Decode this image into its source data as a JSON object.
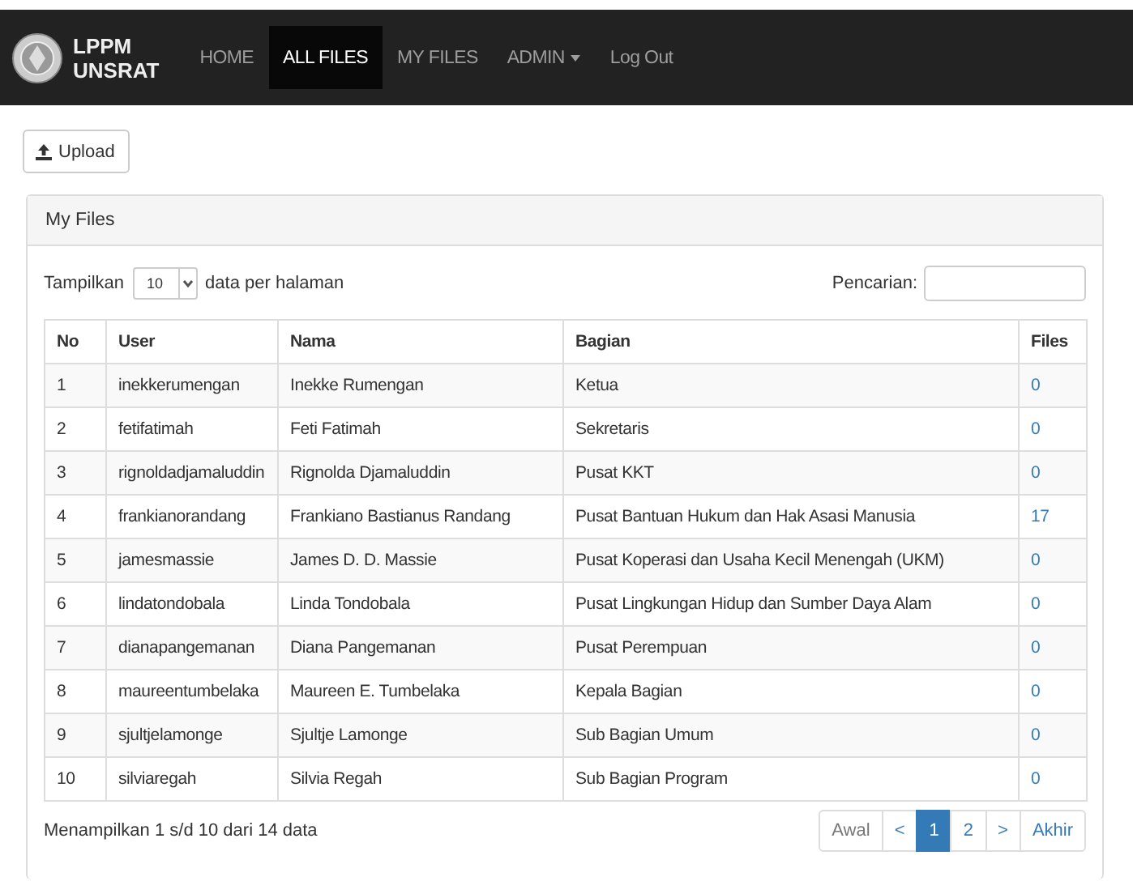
{
  "navbar": {
    "brand": [
      "LPPM",
      "UNSRAT"
    ],
    "items": [
      {
        "label": "HOME",
        "selected": false,
        "kind": "link"
      },
      {
        "label": "ALL FILES",
        "selected": true,
        "kind": "link"
      },
      {
        "label": "MY FILES",
        "selected": false,
        "kind": "link"
      },
      {
        "label": "ADMIN",
        "selected": false,
        "kind": "dropdown"
      },
      {
        "label": "Log Out",
        "selected": false,
        "kind": "link"
      }
    ]
  },
  "upload_button": "Upload",
  "panel": {
    "title": "My Files",
    "length": {
      "prefix": "Tampilkan",
      "value": "10",
      "suffix": "data per halaman"
    },
    "search": {
      "label": "Pencarian:"
    },
    "table": {
      "columns": [
        "No",
        "User",
        "Nama",
        "Bagian",
        "Files"
      ],
      "rows": [
        [
          "1",
          "inekkerumengan",
          "Inekke Rumengan",
          "Ketua",
          "0"
        ],
        [
          "2",
          "fetifatimah",
          "Feti Fatimah",
          "Sekretaris",
          "0"
        ],
        [
          "3",
          "rignoldadjamaluddin",
          "Rignolda Djamaluddin",
          "Pusat KKT",
          "0"
        ],
        [
          "4",
          "frankianorandang",
          "Frankiano Bastianus Randang",
          "Pusat Bantuan Hukum dan Hak Asasi Manusia",
          "17"
        ],
        [
          "5",
          "jamesmassie",
          "James D. D. Massie",
          "Pusat Koperasi dan Usaha Kecil Menengah (UKM)",
          "0"
        ],
        [
          "6",
          "lindatondobala",
          "Linda Tondobala",
          "Pusat Lingkungan Hidup dan Sumber Daya Alam",
          "0"
        ],
        [
          "7",
          "dianapangemanan",
          "Diana Pangemanan",
          "Pusat Perempuan",
          "0"
        ],
        [
          "8",
          "maureentumbelaka",
          "Maureen E. Tumbelaka",
          "Kepala Bagian",
          "0"
        ],
        [
          "9",
          "sjultjelamonge",
          "Sjultje Lamonge",
          "Sub Bagian Umum",
          "0"
        ],
        [
          "10",
          "silviaregah",
          "Silvia Regah",
          "Sub Bagian Program",
          "0"
        ]
      ]
    },
    "info": "Menampilkan 1 s/d 10 dari 14 data",
    "pager": [
      {
        "label": "Awal",
        "disabled": true,
        "selected": false
      },
      {
        "label": "<",
        "disabled": false,
        "selected": false
      },
      {
        "label": "1",
        "disabled": false,
        "selected": true
      },
      {
        "label": "2",
        "disabled": false,
        "selected": false
      },
      {
        "label": ">",
        "disabled": false,
        "selected": false
      },
      {
        "label": "Akhir",
        "disabled": false,
        "selected": false
      }
    ]
  }
}
